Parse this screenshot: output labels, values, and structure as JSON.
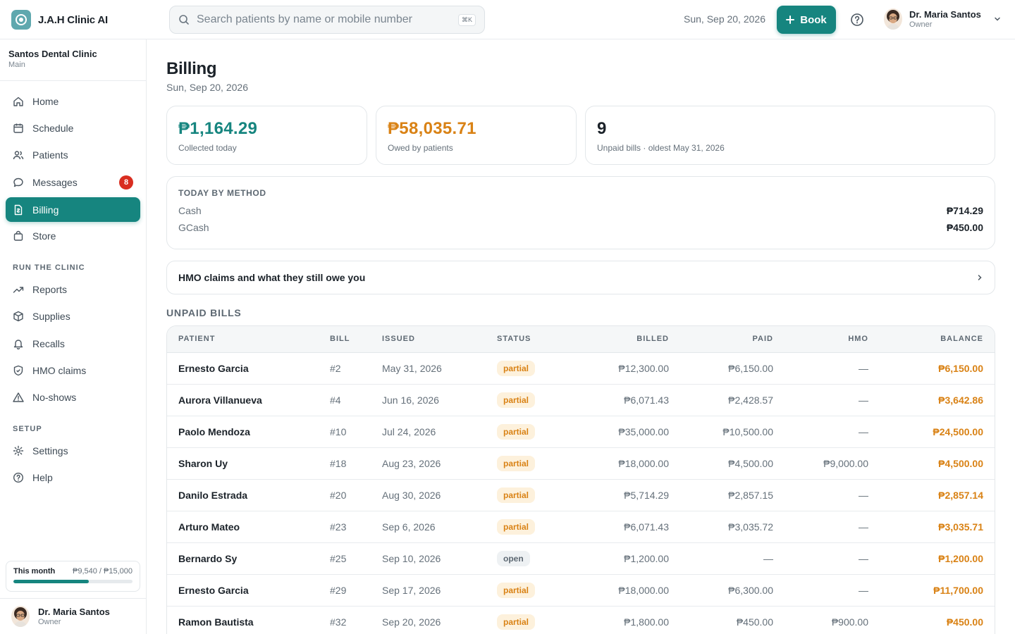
{
  "app": {
    "name": "J.A.H Clinic AI"
  },
  "header": {
    "search_placeholder": "Search patients by name or mobile number",
    "shortcut": "⌘K",
    "date": "Sun, Sep 20, 2026",
    "book_label": "Book",
    "user": {
      "name": "Dr. Maria Santos",
      "role": "Owner"
    }
  },
  "sidebar": {
    "clinic": {
      "name": "Santos Dental Clinic",
      "branch": "Main"
    },
    "primary": [
      {
        "label": "Home",
        "icon": "home-icon"
      },
      {
        "label": "Schedule",
        "icon": "calendar-icon"
      },
      {
        "label": "Patients",
        "icon": "users-icon"
      },
      {
        "label": "Messages",
        "icon": "message-icon",
        "badge": "8"
      },
      {
        "label": "Billing",
        "icon": "receipt-icon",
        "active": true
      },
      {
        "label": "Store",
        "icon": "bag-icon"
      }
    ],
    "run_section": "RUN THE CLINIC",
    "run": [
      {
        "label": "Reports",
        "icon": "trend-icon"
      },
      {
        "label": "Supplies",
        "icon": "box-icon"
      },
      {
        "label": "Recalls",
        "icon": "bell-icon"
      },
      {
        "label": "HMO claims",
        "icon": "shield-icon"
      },
      {
        "label": "No-shows",
        "icon": "warning-icon"
      }
    ],
    "setup_section": "SETUP",
    "setup": [
      {
        "label": "Settings",
        "icon": "gear-icon"
      },
      {
        "label": "Help",
        "icon": "help-icon"
      }
    ],
    "month": {
      "label": "This month",
      "value": "₱9,540 / ₱15,000",
      "progress": 0.636
    },
    "user": {
      "name": "Dr. Maria Santos",
      "role": "Owner"
    }
  },
  "billing": {
    "title": "Billing",
    "date": "Sun, Sep 20, 2026",
    "stats": [
      {
        "value": "₱1,164.29",
        "label": "Collected today",
        "color": "#16857f"
      },
      {
        "value": "₱58,035.71",
        "label": "Owed by patients",
        "color": "#d98215"
      },
      {
        "value": "9",
        "label": "Unpaid bills · oldest May 31, 2026",
        "color": "#1b2229"
      }
    ],
    "today_by_method": {
      "title": "TODAY BY METHOD",
      "rows": [
        {
          "method": "Cash",
          "amount": "₱714.29"
        },
        {
          "method": "GCash",
          "amount": "₱450.00"
        }
      ]
    },
    "hmo_link": "HMO claims and what they still owe you",
    "unpaid_title": "UNPAID BILLS",
    "columns": [
      "PATIENT",
      "BILL",
      "ISSUED",
      "STATUS",
      "BILLED",
      "PAID",
      "HMO",
      "BALANCE"
    ],
    "rows": [
      {
        "patient": "Ernesto Garcia",
        "bill": "#2",
        "issued": "May 31, 2026",
        "status": "partial",
        "billed": "₱12,300.00",
        "paid": "₱6,150.00",
        "hmo": "—",
        "balance": "₱6,150.00"
      },
      {
        "patient": "Aurora Villanueva",
        "bill": "#4",
        "issued": "Jun 16, 2026",
        "status": "partial",
        "billed": "₱6,071.43",
        "paid": "₱2,428.57",
        "hmo": "—",
        "balance": "₱3,642.86"
      },
      {
        "patient": "Paolo Mendoza",
        "bill": "#10",
        "issued": "Jul 24, 2026",
        "status": "partial",
        "billed": "₱35,000.00",
        "paid": "₱10,500.00",
        "hmo": "—",
        "balance": "₱24,500.00"
      },
      {
        "patient": "Sharon Uy",
        "bill": "#18",
        "issued": "Aug 23, 2026",
        "status": "partial",
        "billed": "₱18,000.00",
        "paid": "₱4,500.00",
        "hmo": "₱9,000.00",
        "balance": "₱4,500.00"
      },
      {
        "patient": "Danilo Estrada",
        "bill": "#20",
        "issued": "Aug 30, 2026",
        "status": "partial",
        "billed": "₱5,714.29",
        "paid": "₱2,857.15",
        "hmo": "—",
        "balance": "₱2,857.14"
      },
      {
        "patient": "Arturo Mateo",
        "bill": "#23",
        "issued": "Sep 6, 2026",
        "status": "partial",
        "billed": "₱6,071.43",
        "paid": "₱3,035.72",
        "hmo": "—",
        "balance": "₱3,035.71"
      },
      {
        "patient": "Bernardo Sy",
        "bill": "#25",
        "issued": "Sep 10, 2026",
        "status": "open",
        "billed": "₱1,200.00",
        "paid": "—",
        "hmo": "—",
        "balance": "₱1,200.00"
      },
      {
        "patient": "Ernesto Garcia",
        "bill": "#29",
        "issued": "Sep 17, 2026",
        "status": "partial",
        "billed": "₱18,000.00",
        "paid": "₱6,300.00",
        "hmo": "—",
        "balance": "₱11,700.00"
      },
      {
        "patient": "Ramon Bautista",
        "bill": "#32",
        "issued": "Sep 20, 2026",
        "status": "partial",
        "billed": "₱1,800.00",
        "paid": "₱450.00",
        "hmo": "₱900.00",
        "balance": "₱450.00"
      }
    ]
  }
}
